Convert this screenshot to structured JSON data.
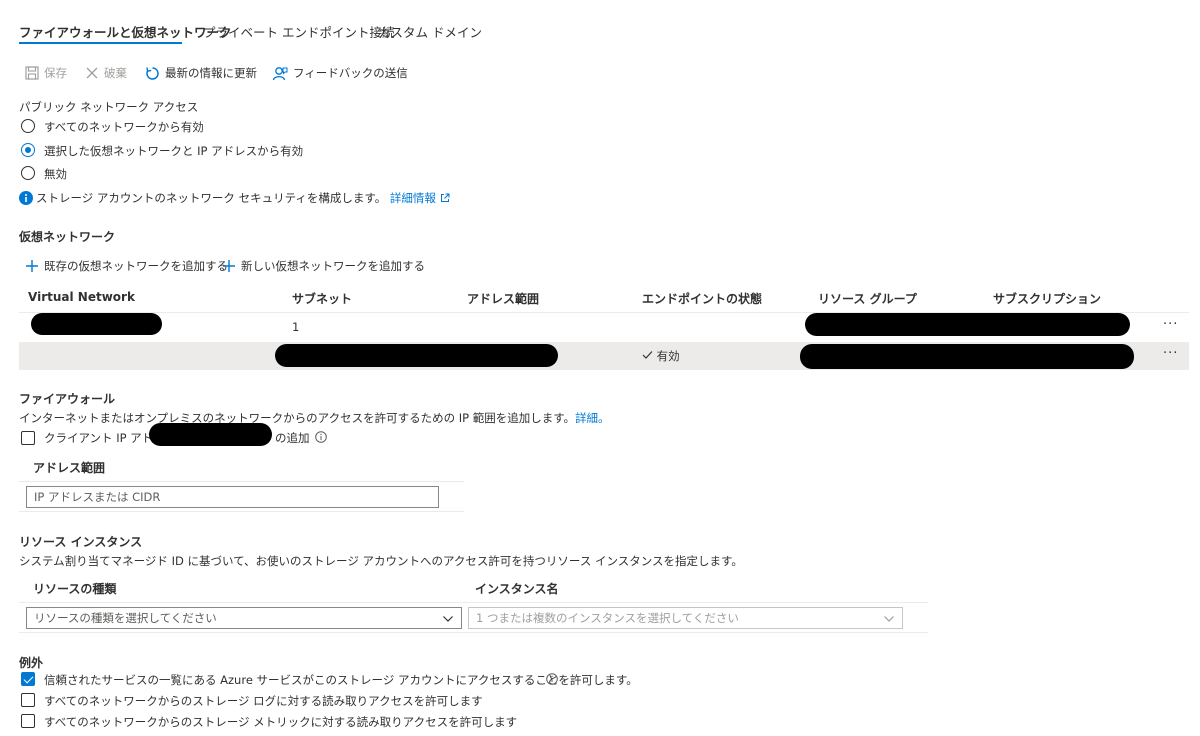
{
  "tabs": [
    {
      "label": "ファイアウォールと仮想ネットワーク",
      "active": true
    },
    {
      "label": "プライベート エンドポイント接続",
      "active": false
    },
    {
      "label": "カスタム ドメイン",
      "active": false
    }
  ],
  "toolbar": {
    "save": "保存",
    "discard": "破棄",
    "refresh": "最新の情報に更新",
    "feedback": "フィードバックの送信"
  },
  "public_access": {
    "label": "パブリック ネットワーク アクセス",
    "options": [
      "すべてのネットワークから有効",
      "選択した仮想ネットワークと IP アドレスから有効",
      "無効"
    ],
    "selected_index": 1,
    "info_text": "ストレージ アカウントのネットワーク セキュリティを構成します。",
    "info_link": "詳細情報"
  },
  "vnet": {
    "title": "仮想ネットワーク",
    "add_existing": "既存の仮想ネットワークを追加する",
    "add_new": "新しい仮想ネットワークを追加する",
    "columns": [
      "Virtual Network",
      "サブネット",
      "アドレス範囲",
      "エンドポイントの状態",
      "リソース グループ",
      "サブスクリプション"
    ],
    "row1_subnet": "1",
    "row2_status": "有効",
    "more": "···"
  },
  "firewall": {
    "title": "ファイアウォール",
    "desc": "インターネットまたはオンプレミスのネットワークからのアクセスを許可するための IP 範囲を追加します。",
    "desc_link": "詳細。",
    "client_ip_prefix": "クライアント IP アドレス",
    "client_ip_suffix": "の追加",
    "address_range_header": "アドレス範囲",
    "address_placeholder": "IP アドレスまたは CIDR"
  },
  "resource_instances": {
    "title": "リソース インスタンス",
    "desc": "システム割り当てマネージド ID に基づいて、お使いのストレージ アカウントへのアクセス許可を持つリソース インスタンスを指定します。",
    "type_header": "リソースの種類",
    "name_header": "インスタンス名",
    "type_placeholder": "リソースの種類を選択してください",
    "name_placeholder": "1 つまたは複数のインスタンスを選択してください"
  },
  "exceptions": {
    "title": "例外",
    "items": [
      {
        "label": "信頼されたサービスの一覧にある Azure サービスがこのストレージ アカウントにアクセスすることを許可します。",
        "checked": true
      },
      {
        "label": "すべてのネットワークからのストレージ ログに対する読み取りアクセスを許可します",
        "checked": false
      },
      {
        "label": "すべてのネットワークからのストレージ メトリックに対する読み取りアクセスを許可します",
        "checked": false
      }
    ]
  },
  "colors": {
    "accent": "#0078d4",
    "text": "#323130",
    "disabled": "#a19f9d"
  }
}
